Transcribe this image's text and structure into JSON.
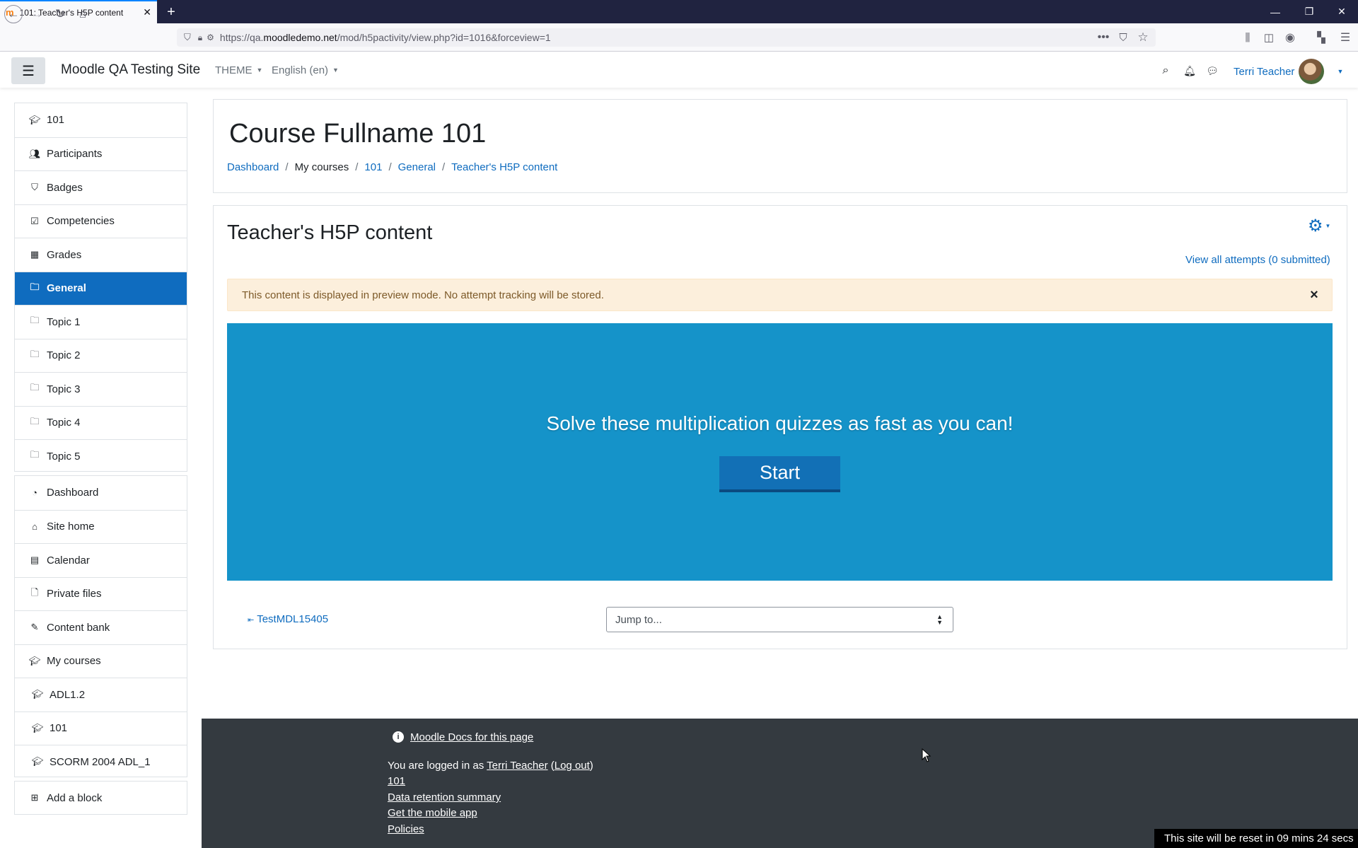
{
  "browser": {
    "tab_title": "101: Teacher's H5P content",
    "url_prefix": "https://qa.",
    "url_domain": "moodledemo.net",
    "url_path": "/mod/h5pactivity/view.php?id=1016&forceview=1"
  },
  "header": {
    "site_name": "Moodle QA Testing Site",
    "theme_label": "THEME",
    "language_label": "English (en)",
    "user_name": "Terri Teacher"
  },
  "nav": {
    "course": [
      {
        "label": "101",
        "icon": "graduation-cap-icon"
      },
      {
        "label": "Participants",
        "icon": "users-icon"
      },
      {
        "label": "Badges",
        "icon": "shield-icon"
      },
      {
        "label": "Competencies",
        "icon": "check-square-icon"
      },
      {
        "label": "Grades",
        "icon": "table-icon"
      },
      {
        "label": "General",
        "icon": "folder-icon"
      },
      {
        "label": "Topic 1",
        "icon": "folder-icon"
      },
      {
        "label": "Topic 2",
        "icon": "folder-icon"
      },
      {
        "label": "Topic 3",
        "icon": "folder-icon"
      },
      {
        "label": "Topic 4",
        "icon": "folder-icon"
      },
      {
        "label": "Topic 5",
        "icon": "folder-icon"
      }
    ],
    "site": [
      {
        "label": "Dashboard",
        "icon": "tachometer-icon"
      },
      {
        "label": "Site home",
        "icon": "home-icon"
      },
      {
        "label": "Calendar",
        "icon": "calendar-icon"
      },
      {
        "label": "Private files",
        "icon": "file-icon"
      },
      {
        "label": "Content bank",
        "icon": "paint-brush-icon"
      },
      {
        "label": "My courses",
        "icon": "graduation-cap-icon"
      },
      {
        "label": "ADL1.2",
        "icon": "graduation-cap-icon"
      },
      {
        "label": "101",
        "icon": "graduation-cap-icon"
      },
      {
        "label": "SCORM 2004 ADL_1",
        "icon": "graduation-cap-icon"
      }
    ],
    "add_block": "Add a block",
    "active_color": "#0f6cbf"
  },
  "page": {
    "course_title": "Course Fullname 101",
    "breadcrumb": [
      {
        "label": "Dashboard",
        "link": true
      },
      {
        "label": "My courses",
        "link": false
      },
      {
        "label": "101",
        "link": true
      },
      {
        "label": "General",
        "link": true
      },
      {
        "label": "Teacher's H5P content",
        "link": true
      }
    ],
    "activity_title": "Teacher's H5P content",
    "view_attempts": "View all attempts (0 submitted)",
    "alert_text": "This content is displayed in preview mode. No attempt tracking will be stored.",
    "h5p_message": "Solve these multiplication quizzes as fast as you can!",
    "start_label": "Start",
    "prev_activity": "TestMDL15405",
    "jump_placeholder": "Jump to..."
  },
  "footer": {
    "docs_link": "Moodle Docs for this page",
    "logged_in_prefix": "You are logged in as",
    "user_link": "Terri Teacher",
    "logout_link": "Log out",
    "course_link": "101",
    "data_retention": "Data retention summary",
    "mobile_app": "Get the mobile app",
    "policies": "Policies",
    "reset_notice": "This site will be reset in 09 mins 24 secs"
  }
}
